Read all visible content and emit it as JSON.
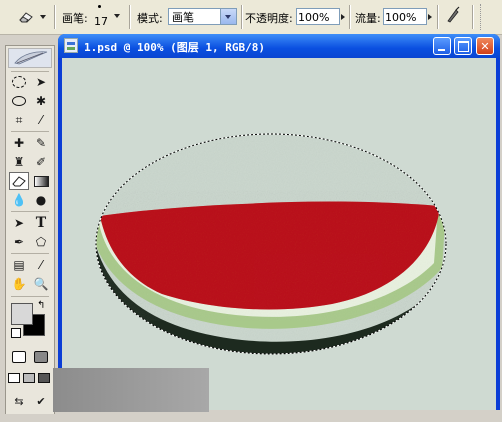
{
  "options_bar": {
    "brush_label": "画笔:",
    "brush_size": "17",
    "mode_label": "模式:",
    "mode_value": "画笔",
    "opacity_label": "不透明度:",
    "opacity_value": "100%",
    "flow_label": "流量:",
    "flow_value": "100%"
  },
  "document": {
    "title": "1.psd @ 100% (图层 1, RGB/8)"
  },
  "colors": {
    "titlebar": "#0a4fe0",
    "canvas_bg": "#cfdad2",
    "watermelon_flesh": "#c8141c",
    "watermelon_rind": "#7fae60"
  },
  "toolbox": {
    "tools": [
      "marquee-icon",
      "move-icon",
      "lasso-icon",
      "magic-wand-icon",
      "crop-icon",
      "slice-icon",
      "healing-brush-icon",
      "brush-icon",
      "clone-stamp-icon",
      "history-brush-icon",
      "eraser-icon",
      "gradient-icon",
      "blur-icon",
      "dodge-icon",
      "path-select-icon",
      "type-icon",
      "pen-icon",
      "shape-icon",
      "notes-icon",
      "eyedropper-icon",
      "hand-icon",
      "zoom-icon"
    ]
  }
}
